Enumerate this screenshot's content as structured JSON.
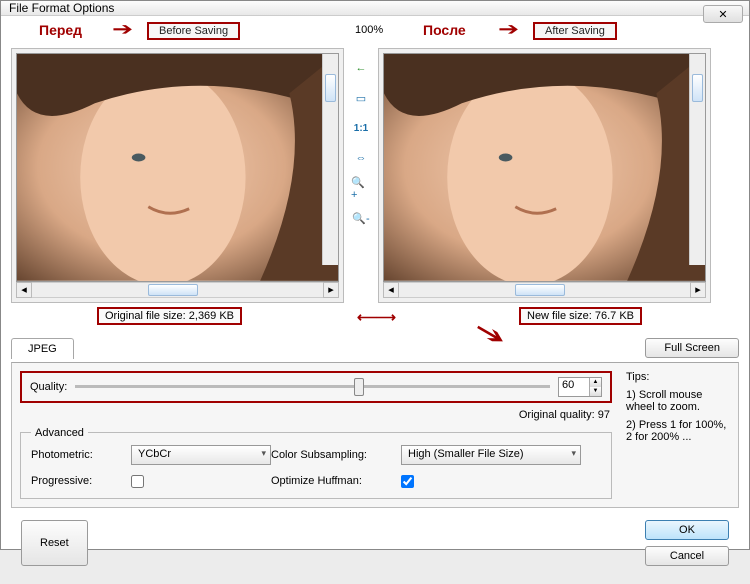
{
  "window": {
    "title": "File Format Options"
  },
  "annotations": {
    "before_word": "Перед",
    "after_word": "После",
    "before_label": "Before Saving",
    "after_label": "After Saving"
  },
  "zoom_percent": "100%",
  "toolbar_icons": [
    "undo-icon",
    "fit-screen-icon",
    "one-to-one-icon",
    "fit-width-icon",
    "zoom-in-icon",
    "zoom-out-icon"
  ],
  "one_to_one": "1:1",
  "sizes": {
    "original_label": "Original file size:",
    "original_value": "2,369 KB",
    "new_label": "New file size:",
    "new_value": "76.7 KB"
  },
  "tab": {
    "jpeg": "JPEG"
  },
  "buttons": {
    "full_screen": "Full Screen",
    "ok": "OK",
    "cancel": "Cancel",
    "reset": "Reset"
  },
  "quality": {
    "label": "Quality:",
    "value": "60",
    "original_label": "Original quality:",
    "original_value": "97"
  },
  "advanced": {
    "legend": "Advanced",
    "photometric_label": "Photometric:",
    "photometric_value": "YCbCr",
    "subsampling_label": "Color Subsampling:",
    "subsampling_value": "High (Smaller File Size)",
    "progressive_label": "Progressive:",
    "progressive_checked": false,
    "huffman_label": "Optimize Huffman:",
    "huffman_checked": true
  },
  "tips": {
    "heading": "Tips:",
    "line1": "1) Scroll mouse wheel to zoom.",
    "line2": "2) Press 1 for 100%, 2 for 200% ..."
  }
}
